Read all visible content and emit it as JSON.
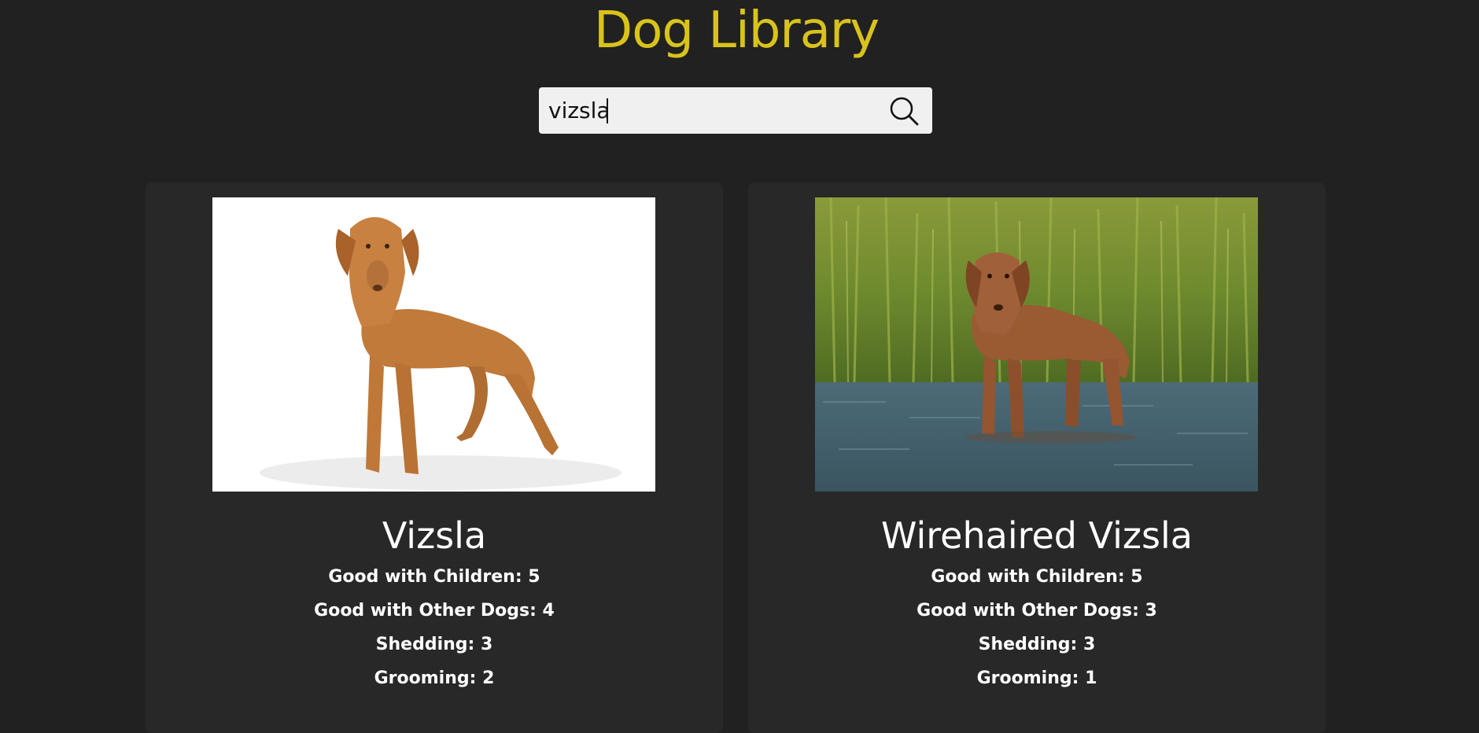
{
  "header": {
    "title": "Dog Library",
    "title_color": "#d9c31a"
  },
  "search": {
    "value": "vizsla",
    "placeholder": "",
    "icon": "search-icon"
  },
  "results": [
    {
      "name": "Vizsla",
      "image": "vizsla-photo",
      "stats": [
        "Good with Children: 5",
        "Good with Other Dogs: 4",
        "Shedding: 3",
        "Grooming: 2"
      ]
    },
    {
      "name": "Wirehaired Vizsla",
      "image": "wirehaired-vizsla-photo",
      "stats": [
        "Good with Children: 5",
        "Good with Other Dogs: 3",
        "Shedding: 3",
        "Grooming: 1"
      ]
    }
  ],
  "colors": {
    "background": "#212121",
    "card": "#282828",
    "text": "#ffffff",
    "accent": "#d9c31a"
  }
}
